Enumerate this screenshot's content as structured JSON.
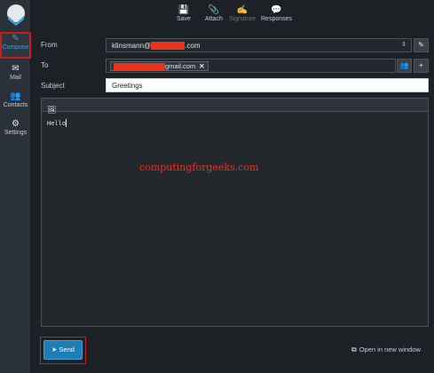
{
  "nav": {
    "compose": "Compose",
    "mail": "Mail",
    "contacts": "Contacts",
    "settings": "Settings"
  },
  "toolbar": {
    "save": "Save",
    "attach": "Attach",
    "signature": "Signature",
    "responses": "Responses"
  },
  "form": {
    "from_label": "From",
    "from_value_prefix": "klinsmann@",
    "from_value_suffix": ".com",
    "to_label": "To",
    "to_token_suffix": "gmail.com",
    "subject_label": "Subject",
    "subject_value": "Greetings"
  },
  "editor": {
    "body": "Hello",
    "watermark": "computingforgeeks.com"
  },
  "footer": {
    "send": "Send",
    "open_new_window": "Open in new window"
  },
  "colors": {
    "accent": "#3ea2d8",
    "send": "#1f7db5",
    "highlight_border": "#c21f1f",
    "redaction": "#e8321e"
  }
}
